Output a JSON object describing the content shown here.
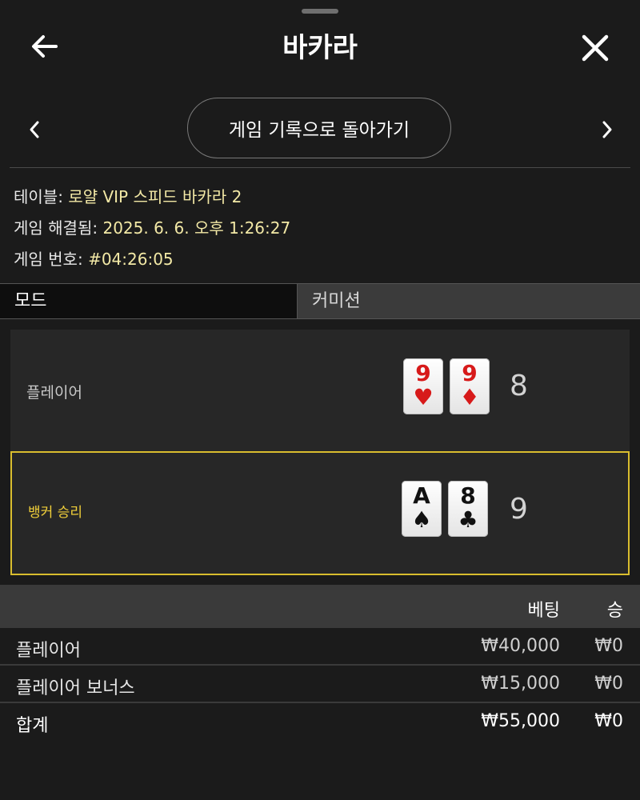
{
  "header": {
    "title": "바카라",
    "back_icon": "arrow-left-icon",
    "close_icon": "close-icon"
  },
  "nav": {
    "back_to_history": "게임 기록으로 돌아가기",
    "prev_icon": "chevron-left-icon",
    "next_icon": "chevron-right-icon"
  },
  "info": {
    "table_label": "테이블:",
    "table_value": "로얄 VIP 스피드 바카라 2",
    "resolved_label": "게임 해결됨:",
    "resolved_value": "2025. 6. 6. 오후 1:26:27",
    "number_label": "게임 번호:",
    "number_value": "#04:26:05"
  },
  "mode": {
    "label": "모드",
    "value": "커미션"
  },
  "result": {
    "player": {
      "label": "플레이어",
      "score": "8",
      "cards": [
        {
          "rank": "9",
          "suit": "♥",
          "color": "#d71a1a"
        },
        {
          "rank": "9",
          "suit": "♦",
          "color": "#d71a1a"
        }
      ]
    },
    "banker": {
      "label": "뱅커 승리",
      "score": "9",
      "cards": [
        {
          "rank": "A",
          "suit": "♠",
          "color": "#111111"
        },
        {
          "rank": "8",
          "suit": "♣",
          "color": "#111111"
        }
      ]
    },
    "highlight_color": "#d9bd2e"
  },
  "bets": {
    "col_bet": "베팅",
    "col_win": "승",
    "rows": [
      {
        "name": "플레이어",
        "amount": "₩40,000",
        "win": "₩0"
      },
      {
        "name": "플레이어 보너스",
        "amount": "₩15,000",
        "win": "₩0"
      }
    ],
    "total": {
      "name": "합계",
      "amount": "₩55,000",
      "win": "₩0"
    }
  }
}
